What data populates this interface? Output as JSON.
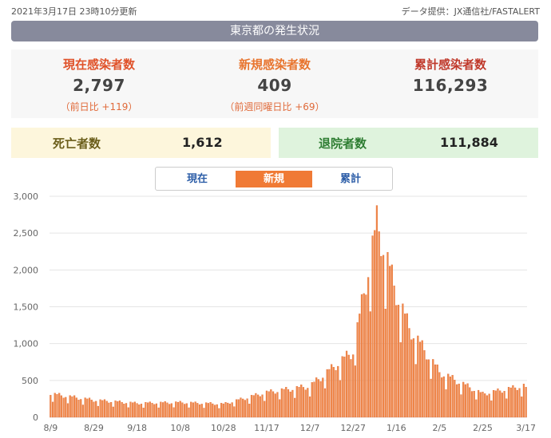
{
  "header": {
    "updated": "2021年3月17日 23時10分更新",
    "source": "データ提供：JX通信社/FASTALERT",
    "title": "東京都の発生状況"
  },
  "stats": {
    "current": {
      "label": "現在感染者数",
      "value": "2,797",
      "sub": "（前日比 +119）"
    },
    "new": {
      "label": "新規感染者数",
      "value": "409",
      "sub": "（前週同曜日比 +69）"
    },
    "total": {
      "label": "累計感染者数",
      "value": "116,293"
    },
    "deaths": {
      "label": "死亡者数",
      "value": "1,612"
    },
    "discharged": {
      "label": "退院者数",
      "value": "111,884"
    }
  },
  "tabs": [
    {
      "label": "現在",
      "active": false
    },
    {
      "label": "新規",
      "active": true
    },
    {
      "label": "累計",
      "active": false
    }
  ],
  "colors": {
    "banner": "#878a9c",
    "current": "#e0522a",
    "new": "#e8752f",
    "total": "#c0392b",
    "deaths_label": "#6b5e1a",
    "deaths_bg": "#fdf6dc",
    "discharged_label": "#2e7d32",
    "discharged_bg": "#dff3dd",
    "bar": "#f08a4b",
    "bar_edge": "#e0622a",
    "tab_active": "#f07a35",
    "tab_text": "#2d5ea8"
  },
  "chart_data": {
    "type": "bar",
    "ylim": [
      0,
      3000
    ],
    "yticks": [
      "0",
      "500",
      "1,000",
      "1,500",
      "2,000",
      "2,500",
      "3,000"
    ],
    "grid": true,
    "x_tick_labels": [
      "8/9",
      "8/29",
      "9/18",
      "10/8",
      "10/28",
      "11/17",
      "12/7",
      "12/27",
      "1/16",
      "2/5",
      "2/25",
      "3/17"
    ],
    "series": [
      {
        "name": "新規",
        "start_date": "2020-08-09",
        "end_date": "2021-03-17",
        "anchors": [
          {
            "date": "2020-08-09",
            "value": 300
          },
          {
            "date": "2020-08-29",
            "value": 220
          },
          {
            "date": "2020-09-18",
            "value": 180
          },
          {
            "date": "2020-10-08",
            "value": 190
          },
          {
            "date": "2020-10-28",
            "value": 170
          },
          {
            "date": "2020-11-17",
            "value": 320
          },
          {
            "date": "2020-12-07",
            "value": 400
          },
          {
            "date": "2020-12-27",
            "value": 850
          },
          {
            "date": "2021-01-07",
            "value": 2500
          },
          {
            "date": "2021-01-16",
            "value": 1600
          },
          {
            "date": "2021-01-22",
            "value": 1150
          },
          {
            "date": "2021-02-05",
            "value": 580
          },
          {
            "date": "2021-02-25",
            "value": 300
          },
          {
            "date": "2021-03-17",
            "value": 409
          }
        ]
      }
    ]
  }
}
